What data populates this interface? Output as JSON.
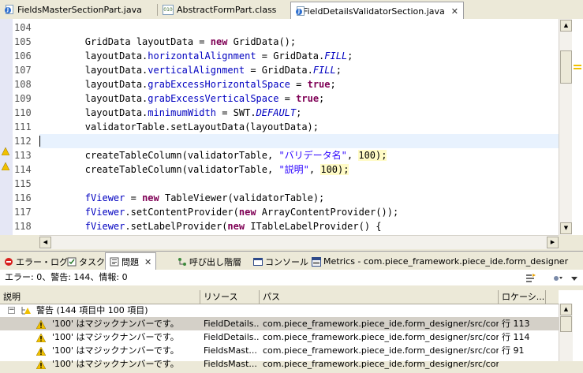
{
  "editor_tabs": [
    {
      "label": "FieldsMasterSectionPart.java",
      "icon": "java-file-icon",
      "active": false
    },
    {
      "label": "AbstractFormPart.class",
      "icon": "class-file-icon",
      "active": false
    },
    {
      "label": "FieldDetailsValidatorSection.java",
      "icon": "java-file-icon",
      "active": true
    }
  ],
  "code_lines": [
    {
      "num": "104",
      "html": ""
    },
    {
      "num": "105",
      "html": "        GridData layoutData = <span class=\"kw\">new</span> GridData();"
    },
    {
      "num": "106",
      "html": "        layoutData.<span class=\"fld\">horizontalAlignment</span> = GridData.<span class=\"ital\">FILL</span>;"
    },
    {
      "num": "107",
      "html": "        layoutData.<span class=\"fld\">verticalAlignment</span> = GridData.<span class=\"ital\">FILL</span>;"
    },
    {
      "num": "108",
      "html": "        layoutData.<span class=\"fld\">grabExcessHorizontalSpace</span> = <span class=\"kw\">true</span>;"
    },
    {
      "num": "109",
      "html": "        layoutData.<span class=\"fld\">grabExcessVerticalSpace</span> = <span class=\"kw\">true</span>;"
    },
    {
      "num": "110",
      "html": "        layoutData.<span class=\"fld\">minimumWidth</span> = SWT.<span class=\"ital\">DEFAULT</span>;"
    },
    {
      "num": "111",
      "html": "        validatorTable.setLayoutData(layoutData);"
    },
    {
      "num": "112",
      "html": ""
    },
    {
      "num": "113",
      "html": "        createTableColumn(validatorTable, <span class=\"str\">\"バリデータ名\"</span>, <span class=\"hl\">100);</span>"
    },
    {
      "num": "114",
      "html": "        createTableColumn(validatorTable, <span class=\"str\">\"説明\"</span>, <span class=\"hl\">100);</span>"
    },
    {
      "num": "115",
      "html": ""
    },
    {
      "num": "116",
      "html": "        <span class=\"fld\">fViewer</span> = <span class=\"kw\">new</span> TableViewer(validatorTable);"
    },
    {
      "num": "117",
      "html": "        <span class=\"fld\">fViewer</span>.setContentProvider(<span class=\"kw\">new</span> ArrayContentProvider());"
    },
    {
      "num": "118",
      "html": "        <span class=\"fld\">fViewer</span>.setLabelProvider(<span class=\"kw\">new</span> ITableLabelProvider() {"
    }
  ],
  "view_tabs": [
    {
      "label": "エラー・ログ",
      "icon": "error-log-icon",
      "active": false
    },
    {
      "label": "タスク",
      "icon": "tasks-icon",
      "active": false
    },
    {
      "label": "問題",
      "icon": "problems-icon",
      "active": true
    },
    {
      "label": "呼び出し階層",
      "icon": "call-hierarchy-icon",
      "active": false
    },
    {
      "label": "コンソール",
      "icon": "console-icon",
      "active": false
    },
    {
      "label": "Metrics - com.piece_framework.piece_ide.form_designer",
      "icon": "metrics-icon",
      "active": false
    }
  ],
  "problems": {
    "summary": "エラー: 0、警告: 144、情報: 0",
    "columns": [
      "説明",
      "リソース",
      "パス",
      "ロケーシ..."
    ],
    "group_label": "警告 (144 項目中 100 項目)",
    "rows": [
      {
        "desc": "'100' はマジックナンバーです。",
        "resource": "FieldDetails...",
        "path": "com.piece_framework.piece_ide.form_designer/src/com/pi...",
        "location": "行 113",
        "selected": true
      },
      {
        "desc": "'100' はマジックナンバーです。",
        "resource": "FieldDetails...",
        "path": "com.piece_framework.piece_ide.form_designer/src/com/pi...",
        "location": "行 114",
        "selected": false
      },
      {
        "desc": "'100' はマジックナンバーです。",
        "resource": "FieldsMast...",
        "path": "com.piece_framework.piece_ide.form_designer/src/com/pi...",
        "location": "行 91",
        "selected": false
      },
      {
        "desc": "'100' はマジックナンバーです。",
        "resource": "FieldsMast...",
        "path": "com.piece_framework.piece_ide.form_designer/src/com/pi...",
        "location": "",
        "selected": false
      }
    ]
  }
}
